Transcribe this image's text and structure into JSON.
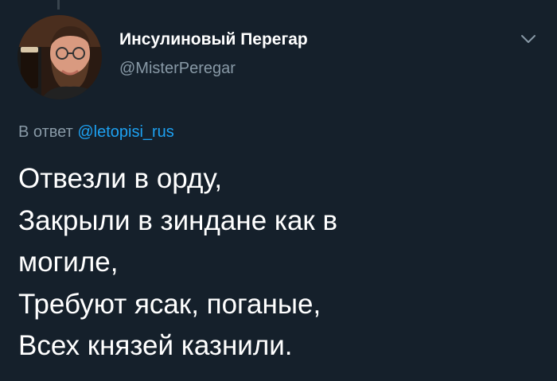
{
  "tweet": {
    "display_name": "Инсулиновый Перегар",
    "handle": "@MisterPeregar",
    "reply_prefix": "В ответ",
    "reply_mention": "@letopisi_rus",
    "text_lines": [
      "Отвезли в орду,",
      "Закрыли в зиндане как в",
      "могиле,",
      "Требуют ясак, поганые,",
      "Всех князей казнили."
    ]
  },
  "icons": {
    "menu": "chevron-down-icon",
    "avatar": "profile-photo"
  },
  "colors": {
    "background": "#15202b",
    "text_primary": "#ffffff",
    "text_secondary": "#8899a6",
    "accent": "#1da1f2"
  }
}
